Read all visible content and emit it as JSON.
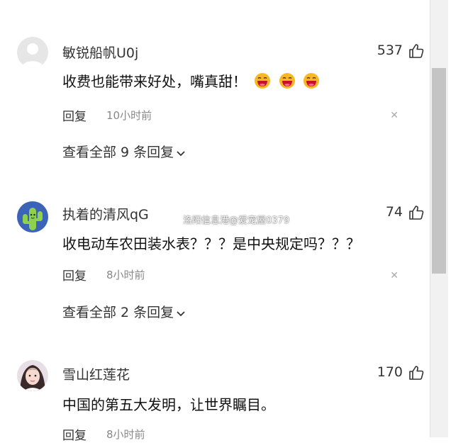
{
  "watermark": "洛阳信息港@爱宠屋0379",
  "comments": [
    {
      "username": "敏锐船帆U0j",
      "likes": "537",
      "text": "收费也能带来好处，嘴真甜！",
      "reply_label": "回复",
      "time": "10小时前",
      "view_all": "查看全部 9 条回复",
      "avatar": "default-avatar"
    },
    {
      "username": "执着的清风qG",
      "likes": "74",
      "text": "收电动车农田装水表？？？是中央规定吗？？？",
      "reply_label": "回复",
      "time": "8小时前",
      "view_all": "查看全部 2 条回复",
      "avatar": "cactus-avatar"
    },
    {
      "username": "雪山红莲花",
      "likes": "170",
      "text": "中国的第五大发明，让世界瞩目。",
      "reply_label": "回复",
      "time": "8小时前",
      "avatar": "photo-avatar"
    }
  ],
  "icons": {
    "like": "thumbs-up-icon",
    "close": "close-icon",
    "chevron": "chevron-down-icon",
    "emoji": "laughing-emoji-icon"
  }
}
